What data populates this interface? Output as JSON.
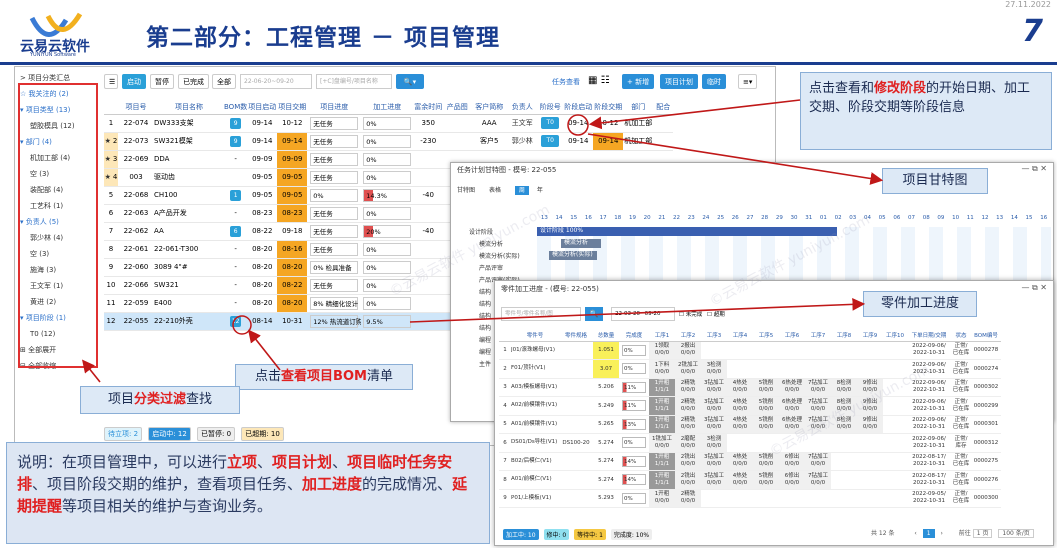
{
  "header": {
    "logo_text": "云易云软件",
    "logo_sub": "YUNIYUN Software",
    "title": "第二部分：工程管理 － 项目管理",
    "date": "27.11.2022",
    "page_number": "7"
  },
  "sidebar": {
    "items": [
      {
        "label": "> 项目分类汇总",
        "level": 1
      },
      {
        "label": "☆ 我关注的 (2)",
        "level": 1
      },
      {
        "label": "▾ 项目类型 (13)",
        "level": 1
      },
      {
        "label": "塑胶模具 (12)",
        "level": 2
      },
      {
        "label": "▾ 部门 (4)",
        "level": 1
      },
      {
        "label": "机加工部 (4)",
        "level": 2
      },
      {
        "label": "空 (3)",
        "level": 2
      },
      {
        "label": "装配部 (4)",
        "level": 2
      },
      {
        "label": "工艺科 (1)",
        "level": 2
      },
      {
        "label": "▾ 负责人 (5)",
        "level": 1
      },
      {
        "label": "郭少林 (4)",
        "level": 2
      },
      {
        "label": "空 (3)",
        "level": 2
      },
      {
        "label": "施海 (3)",
        "level": 2
      },
      {
        "label": "王文军 (1)",
        "level": 2
      },
      {
        "label": "黄进 (2)",
        "level": 2
      },
      {
        "label": "▾ 项目阶段 (1)",
        "level": 1
      },
      {
        "label": "T0 (12)",
        "level": 2
      },
      {
        "label": "⊞ 全部展开",
        "level": 1
      },
      {
        "label": "⊟ 全部收缩",
        "level": 1
      }
    ]
  },
  "toolbar": {
    "btn_start": "启动",
    "btn_pause": "暂停",
    "btn_done": "已完成",
    "btn_all": "全部",
    "date_range": "22-06-20~09-20",
    "search_placeholder": "[+C]盘编号/项目名称",
    "task_view": "任务查看",
    "btn_new": "+ 新增",
    "btn_plan": "项目计划",
    "btn_temp": "临时"
  },
  "main_table": {
    "headers": [
      "",
      "项目号",
      "项目名称",
      "BOM数",
      "项目启动",
      "项目交期",
      "项目进度",
      "加工进度",
      "富余时间",
      "产品图",
      "客户简称",
      "负责人",
      "阶段号",
      "阶段启动",
      "阶段交期",
      "部门",
      "配合"
    ],
    "rows": [
      {
        "n": "1",
        "id": "22-074",
        "name": "DW333支架",
        "bom": "9",
        "start": "09-14",
        "due": "10-12",
        "prog": "无任务",
        "mach": "0%",
        "spare": "350",
        "cust": "AAA",
        "owner": "王文军",
        "stage": "T0",
        "sstart": "09-14",
        "sdue": "10-12",
        "dept": "机加工部",
        "star": false
      },
      {
        "n": "2",
        "id": "22-073",
        "name": "SW321模架",
        "bom": "9",
        "start": "09-14",
        "due": "09-14",
        "prog": "无任务",
        "mach": "0%",
        "spare": "-230",
        "cust": "客户5",
        "owner": "郭少林",
        "stage": "T0",
        "sstart": "09-14",
        "sdue": "09-14",
        "dept": "机加工部",
        "star": true
      },
      {
        "n": "3",
        "id": "22-069",
        "name": "DDA",
        "bom": "-",
        "start": "09-09",
        "due": "09-09",
        "prog": "无任务",
        "mach": "0%",
        "spare": "",
        "cust": "",
        "owner": "",
        "stage": "",
        "sstart": "",
        "sdue": "",
        "dept": "",
        "star": true
      },
      {
        "n": "4",
        "id": "003",
        "name": "驱动齿",
        "bom": "",
        "start": "09-05",
        "due": "09-05",
        "prog": "无任务",
        "mach": "0%",
        "spare": "",
        "cust": "",
        "owner": "",
        "stage": "",
        "sstart": "",
        "sdue": "",
        "dept": "",
        "star": true
      },
      {
        "n": "5",
        "id": "22-068",
        "name": "CH100",
        "bom": "1",
        "start": "09-05",
        "due": "09-05",
        "prog": "0%",
        "mach": "14.3%",
        "spare": "-40",
        "cust": "",
        "owner": "",
        "stage": "",
        "sstart": "",
        "sdue": "",
        "dept": "",
        "star": false
      },
      {
        "n": "6",
        "id": "22-063",
        "name": "A产品开发",
        "bom": "-",
        "start": "08-23",
        "due": "08-23",
        "prog": "无任务",
        "mach": "0%",
        "spare": "",
        "cust": "",
        "owner": "",
        "stage": "",
        "sstart": "",
        "sdue": "",
        "dept": "",
        "star": false
      },
      {
        "n": "7",
        "id": "22-062",
        "name": "AA",
        "bom": "6",
        "start": "08-22",
        "due": "09-18",
        "prog": "无任务",
        "mach": "20%",
        "spare": "-40",
        "cust": "",
        "owner": "",
        "stage": "",
        "sstart": "",
        "sdue": "",
        "dept": "",
        "star": false
      },
      {
        "n": "8",
        "id": "22-061",
        "name": "22-061-T300",
        "bom": "-",
        "start": "08-20",
        "due": "08-16",
        "prog": "无任务",
        "mach": "0%",
        "spare": "",
        "cust": "",
        "owner": "",
        "stage": "",
        "sstart": "",
        "sdue": "",
        "dept": "",
        "star": false
      },
      {
        "n": "9",
        "id": "22-060",
        "name": "3089 4\"#",
        "bom": "-",
        "start": "08-20",
        "due": "08-20",
        "prog": "0% 检具准备",
        "mach": "0%",
        "spare": "",
        "cust": "",
        "owner": "",
        "stage": "",
        "sstart": "",
        "sdue": "",
        "dept": "",
        "star": false
      },
      {
        "n": "10",
        "id": "22-066",
        "name": "SW321",
        "bom": "-",
        "start": "08-20",
        "due": "08-22",
        "prog": "无任务",
        "mach": "0%",
        "spare": "",
        "cust": "",
        "owner": "",
        "stage": "",
        "sstart": "",
        "sdue": "",
        "dept": "",
        "star": false
      },
      {
        "n": "11",
        "id": "22-059",
        "name": "E400",
        "bom": "-",
        "start": "08-20",
        "due": "08-20",
        "prog": "8% 精细化设计",
        "mach": "0%",
        "spare": "",
        "cust": "",
        "owner": "",
        "stage": "",
        "sstart": "",
        "sdue": "",
        "dept": "",
        "star": false
      },
      {
        "n": "12",
        "id": "22-055",
        "name": "22-210外壳",
        "bom": "12",
        "start": "08-14",
        "due": "10-31",
        "prog": "12% 热流道订购",
        "mach": "9.5%",
        "spare": "",
        "cust": "",
        "owner": "",
        "stage": "",
        "sstart": "",
        "sdue": "",
        "dept": "",
        "star": false
      }
    ]
  },
  "status_bar": {
    "pending": "待立项: 2",
    "started": "启动中: 12",
    "paused": "已暂停: 0",
    "overdue": "已超期: 10"
  },
  "gantt": {
    "title": "任务计划甘特图 - 模号: 22-055",
    "tabs": [
      "甘特图",
      "表格",
      "周",
      "年"
    ],
    "bar_main": "设计阶段 100%",
    "bar_1": "模流分析",
    "bar_2": "模流分析(实际)",
    "rows": [
      "设计阶段",
      "模流分析",
      "模流分析(实际)",
      "产品评审",
      "产品评审(实际)",
      "结构",
      "结构",
      "结构",
      "结构",
      "编程",
      "编程",
      "主件"
    ],
    "days": [
      "13",
      "14",
      "15",
      "16",
      "17",
      "18",
      "19",
      "20",
      "21",
      "22",
      "23",
      "24",
      "25",
      "26",
      "27",
      "28",
      "29",
      "30",
      "31",
      "01",
      "02",
      "03",
      "04",
      "05",
      "06",
      "07",
      "08",
      "09",
      "10",
      "11",
      "12",
      "13",
      "14",
      "15",
      "16"
    ]
  },
  "part_window": {
    "title": "零件加工进度 - (模号: 22-055)",
    "search_placeholder": "零件号/零件名称/图",
    "date_range": "22-03-20~09-20",
    "chk_unfinished": "未完成",
    "chk_overdue": "超期",
    "headers": [
      "",
      "零件号",
      "零件规格",
      "总数量",
      "完成度",
      "工序1",
      "工序2",
      "工序3",
      "工序4",
      "工序5",
      "工序6",
      "工序7",
      "工序8",
      "工序9",
      "工序10",
      "下单日期/交期",
      "状态",
      "BOM编号"
    ],
    "rows": [
      {
        "n": "1",
        "id": "J01/滚珠螺母(V1)",
        "spec": "",
        "qty": "1.051",
        "pct": "0%",
        "p1": "1领取 0/0/0",
        "p2": "2报出 0/0/0",
        "p3": "",
        "p4": "",
        "p5": "",
        "p6": "",
        "p7": "",
        "p8": "",
        "p9": "",
        "date": "2022-09-06/ 2022-10-31",
        "status": "正常/ 已在库",
        "bom": "0000278"
      },
      {
        "n": "2",
        "id": "F01/顶针(V1)",
        "spec": "",
        "qty": "3.07",
        "pct": "0%",
        "p1": "1下料 0/0/0",
        "p2": "2铣加工 0/0/0",
        "p3": "3检测 0/0/0",
        "p4": "",
        "p5": "",
        "p6": "",
        "p7": "",
        "p8": "",
        "p9": "",
        "date": "2022-09-06/ 2022-10-31",
        "status": "正常/ 已在库",
        "bom": "0000274"
      },
      {
        "n": "3",
        "id": "A03/模板螺母(V1)",
        "spec": "",
        "qty": "5.206",
        "pct": "11%",
        "p1": "1开粗 1/1/1",
        "p2": "2精铣 0/0/0",
        "p3": "3钻加工 0/0/0",
        "p4": "4热处 0/0/0",
        "p5": "5铣削 0/0/0",
        "p6": "6热处理 0/0/0",
        "p7": "7钻加工 0/0/0",
        "p8": "8检测 0/0/0",
        "p9": "9修出 0/0/0",
        "date": "2022-09-06/ 2022-10-31",
        "status": "正常/ 已在库",
        "bom": "0000302"
      },
      {
        "n": "4",
        "id": "A02/前模镶件(V1)",
        "spec": "",
        "qty": "5.249",
        "pct": "11%",
        "p1": "1开粗 1/1/1",
        "p2": "2精铣 0/0/0",
        "p3": "3钻加工 0/0/0",
        "p4": "4热处 0/0/0",
        "p5": "5铣削 0/0/0",
        "p6": "6热处理 0/0/0",
        "p7": "7钻加工 0/0/0",
        "p8": "8检测 0/0/0",
        "p9": "9修出 0/0/0",
        "date": "2022-09-06/ 2022-10-31",
        "status": "正常/ 已在库",
        "bom": "0000299"
      },
      {
        "n": "5",
        "id": "A01/前模镶件(V1)",
        "spec": "",
        "qty": "5.265",
        "pct": "13%",
        "p1": "1开粗 1/1/1",
        "p2": "2精铣 0/0/0",
        "p3": "3钻加工 0/0/0",
        "p4": "4热处 0/0/0",
        "p5": "5铣削 0/0/0",
        "p6": "6热处理 0/0/0",
        "p7": "7钻加工 0/0/0",
        "p8": "8检测 0/0/0",
        "p9": "9修出 0/0/0",
        "date": "2022-09-06/ 2022-10-31",
        "status": "正常/ 已在库",
        "bom": "0000301"
      },
      {
        "n": "6",
        "id": "DS01/Ds导柱(V1)",
        "spec": "DS100-20",
        "qty": "5.274",
        "pct": "0%",
        "p1": "1铣加工 0/0/0",
        "p2": "2磨配 0/0/0",
        "p3": "3检测 0/0/0",
        "p4": "",
        "p5": "",
        "p6": "",
        "p7": "",
        "p8": "",
        "p9": "",
        "date": "2022-09-06/ 2022-10-31",
        "status": "正常/ 库存",
        "bom": "0000312"
      },
      {
        "n": "7",
        "id": "B02/后模仁(V1)",
        "spec": "",
        "qty": "5.274",
        "pct": "14%",
        "p1": "1开粗 1/1/1",
        "p2": "2铣出 0/0/0",
        "p3": "3钻加工 0/0/0",
        "p4": "4热处 0/0/0",
        "p5": "5铣削 0/0/0",
        "p6": "6修出 0/0/0",
        "p7": "7钻加工 0/0/0",
        "p8": "",
        "p9": "",
        "date": "2022-08-17/ 2022-10-31",
        "status": "正常/ 已在库",
        "bom": "0000275"
      },
      {
        "n": "8",
        "id": "A01/前模仁(V1)",
        "spec": "",
        "qty": "5.274",
        "pct": "14%",
        "p1": "1开粗 1/1/1",
        "p2": "2铣出 0/0/0",
        "p3": "3钻加工 0/0/0",
        "p4": "4热处 0/0/0",
        "p5": "5铣削 0/0/0",
        "p6": "6修出 0/0/0",
        "p7": "7钻加工 0/0/0",
        "p8": "",
        "p9": "",
        "date": "2022-08-17/ 2022-10-31",
        "status": "正常/ 已在库",
        "bom": "0000276"
      },
      {
        "n": "9",
        "id": "P01/上模板(V1)",
        "spec": "",
        "qty": "5.293",
        "pct": "0%",
        "p1": "1开粗 0/0/0",
        "p2": "2精铣 0/0/0",
        "p3": "",
        "p4": "",
        "p5": "",
        "p6": "",
        "p7": "",
        "p8": "",
        "p9": "",
        "date": "2022-09-05/ 2022-10-31",
        "status": "正常/ 已在库",
        "bom": "0000300"
      }
    ],
    "status": {
      "processing": "加工中: 10",
      "repair": "修中: 0",
      "waiting": "等待中: 1",
      "done": "完成度: 10%"
    },
    "pager": {
      "total": "共 12 条",
      "page": "1",
      "goto": "前往",
      "page_suffix": "1 页",
      "per_page": "100 条/页"
    }
  },
  "callouts": {
    "stage_pre": "点击查看和",
    "stage_em": "修改阶段",
    "stage_post": "的开始日期、加工交期、阶段交期等阶段信息",
    "gantt": "项目甘特图",
    "part": "零件加工进度",
    "bom_pre": "点击",
    "bom_em": "查看项目BOM",
    "bom_post": "清单",
    "filter_pre": "项目",
    "filter_em": "分类过滤",
    "filter_post": "查找",
    "desc_1": "说明：在项目管理中，可以进行",
    "desc_e1": "立项",
    "desc_2": "、",
    "desc_e2": "项目计划",
    "desc_3": "、",
    "desc_e3": "项目临时任务安排",
    "desc_4": "、项目阶段交期的维护，查看项目任务、",
    "desc_e4": "加工进度",
    "desc_5": "的完成情况、",
    "desc_e5": "延期提醒",
    "desc_6": "等项目相关的维护与查询业务。"
  },
  "colors": {
    "brand": "#1a3d8f",
    "accent": "#2aa0d8",
    "highlight": "#e02020",
    "orange": "#f5a623"
  }
}
